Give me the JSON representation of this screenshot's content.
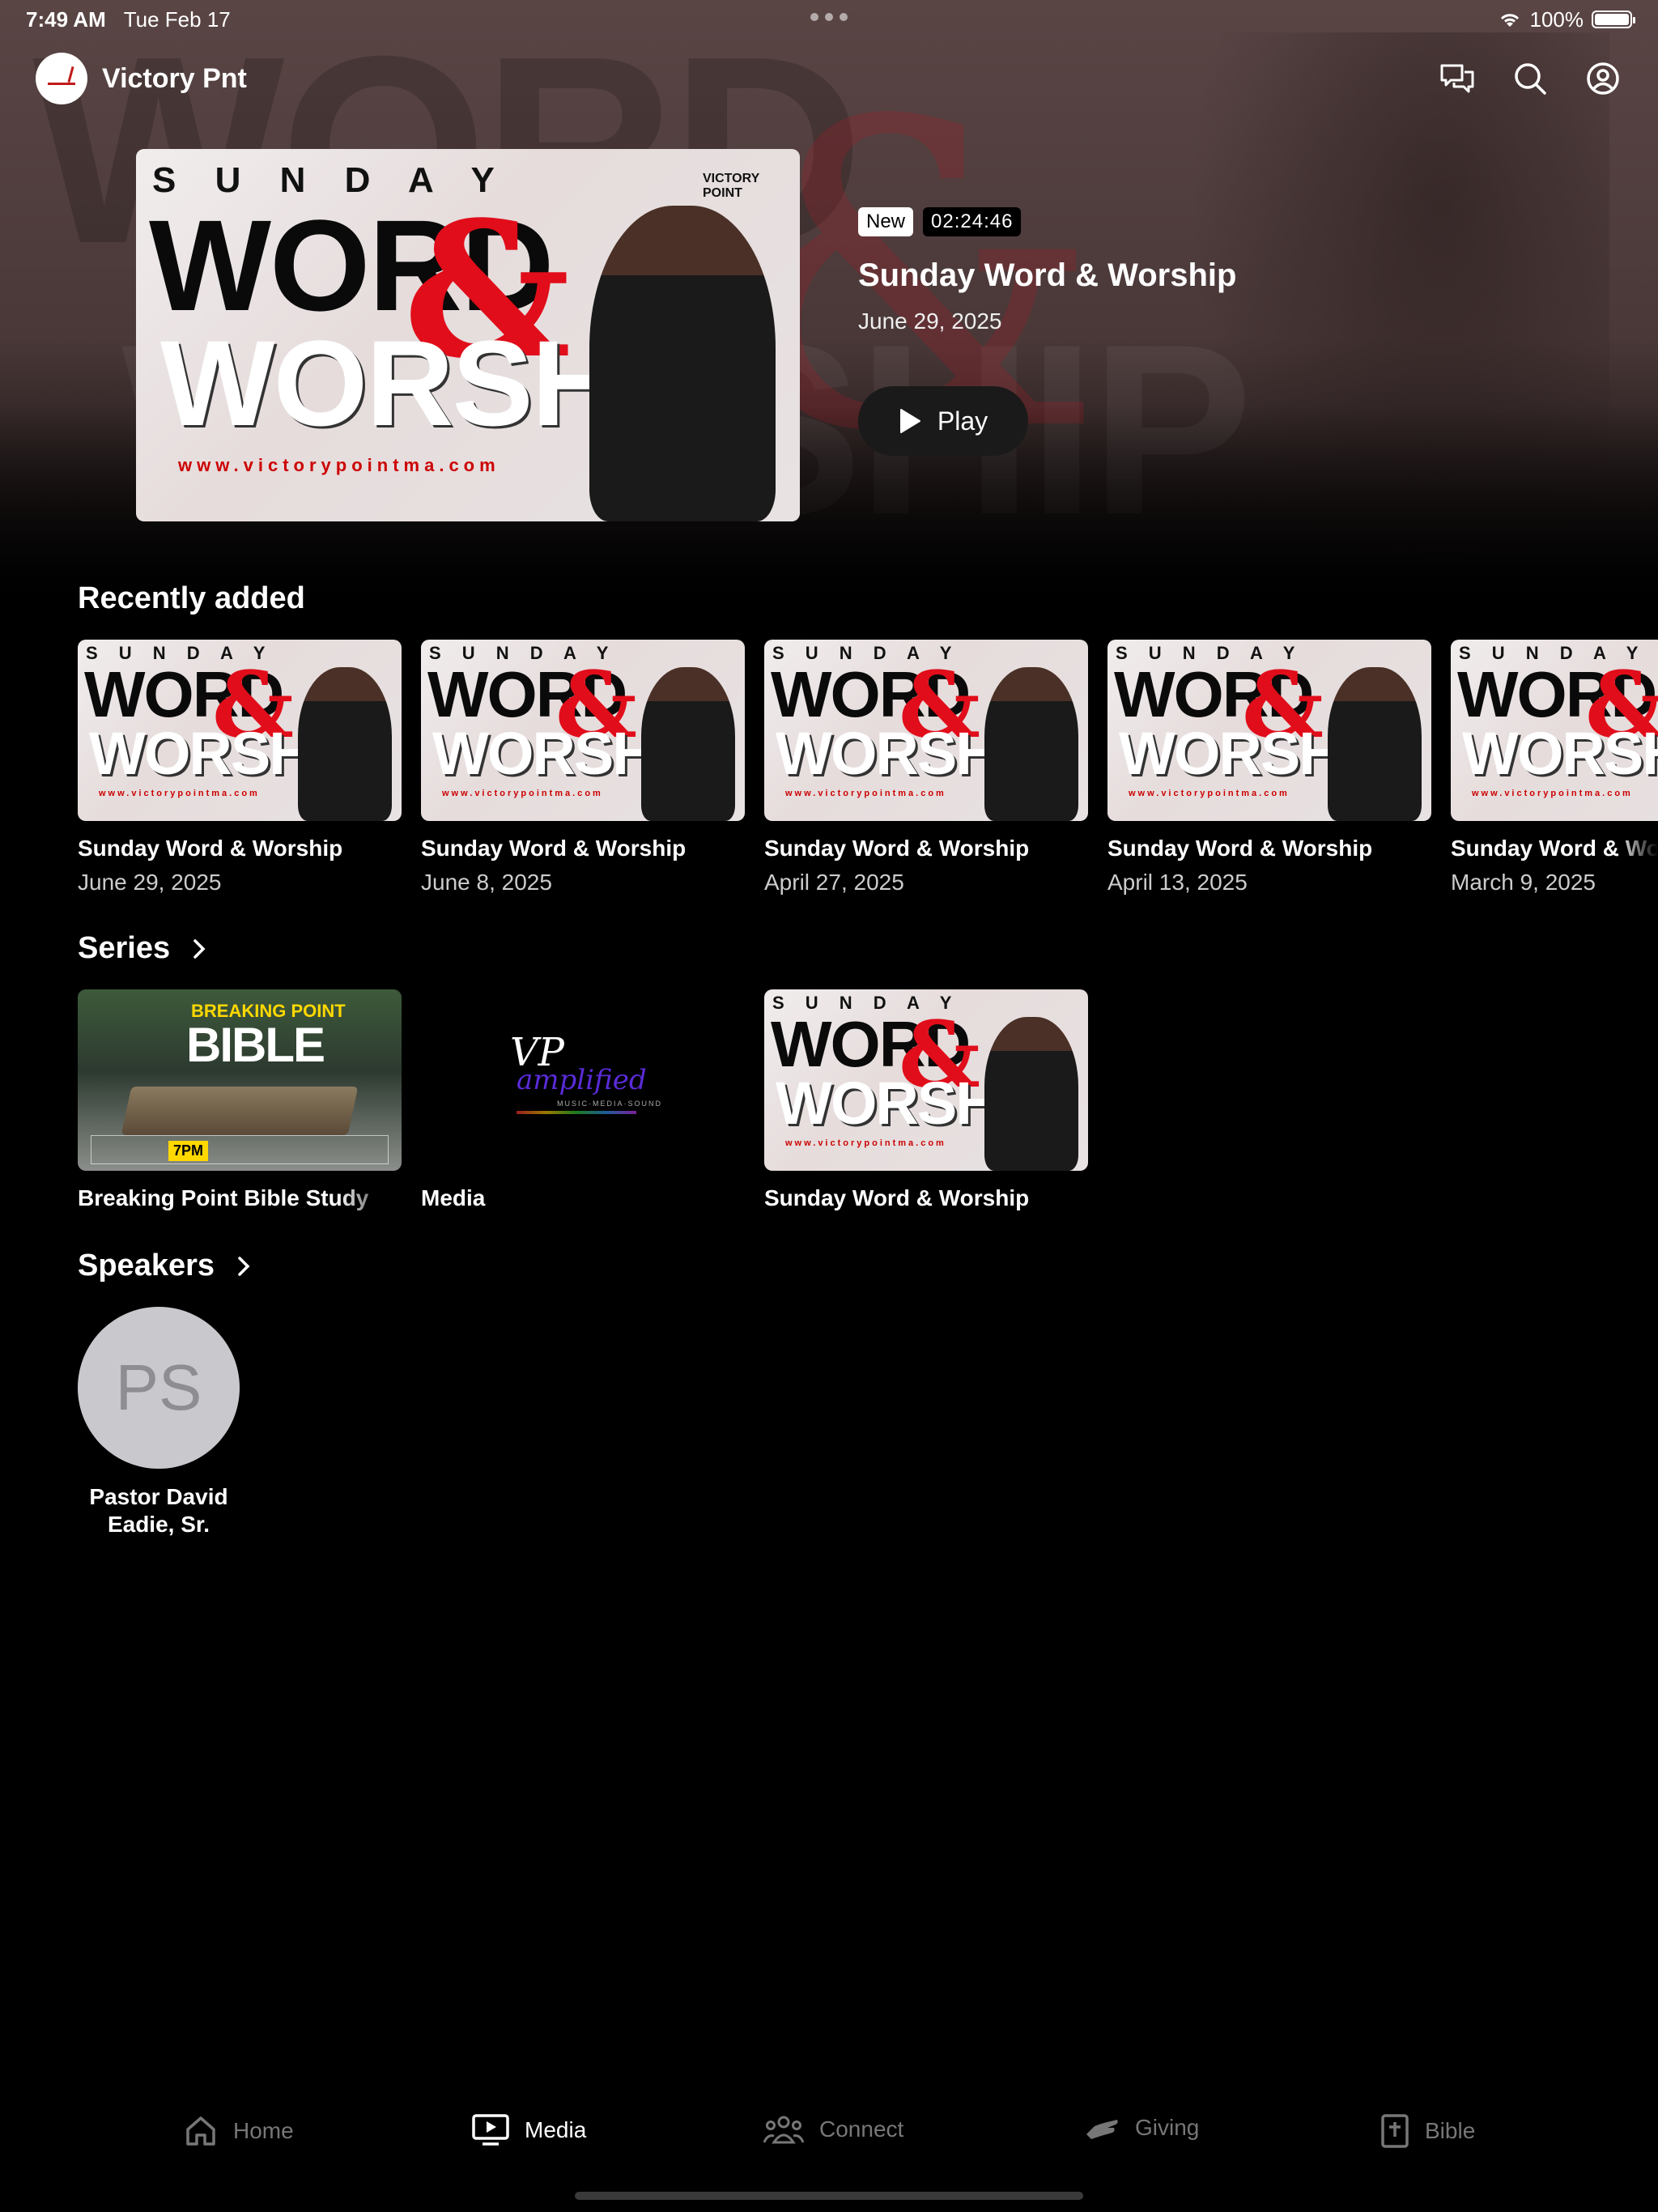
{
  "status": {
    "time": "7:49 AM",
    "date": "Tue Feb 17",
    "battery": "100%"
  },
  "nav": {
    "app_title": "Victory Pnt"
  },
  "featured": {
    "badge_new": "New",
    "duration": "02:24:46",
    "title": "Sunday Word & Worship",
    "date": "June 29, 2025",
    "play_label": "Play"
  },
  "artwork": {
    "sunday": "S U N D A Y",
    "word": "WORD",
    "amp": "&",
    "worship": "WORSHIP",
    "url": "www.victorypointma.com",
    "logo": "VICTORY POINT"
  },
  "recent": {
    "heading": "Recently added",
    "items": [
      {
        "title": "Sunday Word & Worship",
        "date": "June 29, 2025"
      },
      {
        "title": "Sunday Word & Worship",
        "date": "June 8, 2025"
      },
      {
        "title": "Sunday Word & Worship",
        "date": "April 27, 2025"
      },
      {
        "title": "Sunday Word & Worship",
        "date": "April 13, 2025"
      },
      {
        "title": "Sunday Word & Worship",
        "date": "March 9, 2025"
      }
    ]
  },
  "series": {
    "heading": "Series",
    "items": [
      {
        "title": "Breaking Point Bible Study"
      },
      {
        "title": "Media"
      },
      {
        "title": "Sunday Word & Worship"
      }
    ],
    "bible_art": {
      "top": "BREAKING POINT",
      "main": "BIBLE",
      "time": "7PM"
    },
    "media_art": {
      "vp": "VP",
      "word": "amplified",
      "sub": "MUSIC·MEDIA·SOUND"
    }
  },
  "speakers": {
    "heading": "Speakers",
    "items": [
      {
        "initials": "PS",
        "name": "Pastor David Eadie, Sr."
      }
    ]
  },
  "tabs": [
    {
      "label": "Home",
      "icon": "home-icon"
    },
    {
      "label": "Media",
      "icon": "tv-icon"
    },
    {
      "label": "Connect",
      "icon": "people-icon"
    },
    {
      "label": "Giving",
      "icon": "hand-icon"
    },
    {
      "label": "Bible",
      "icon": "bible-icon"
    }
  ],
  "colors": {
    "accent": "#e10d1a",
    "background": "#000000",
    "inactive_tab": "#777777"
  }
}
